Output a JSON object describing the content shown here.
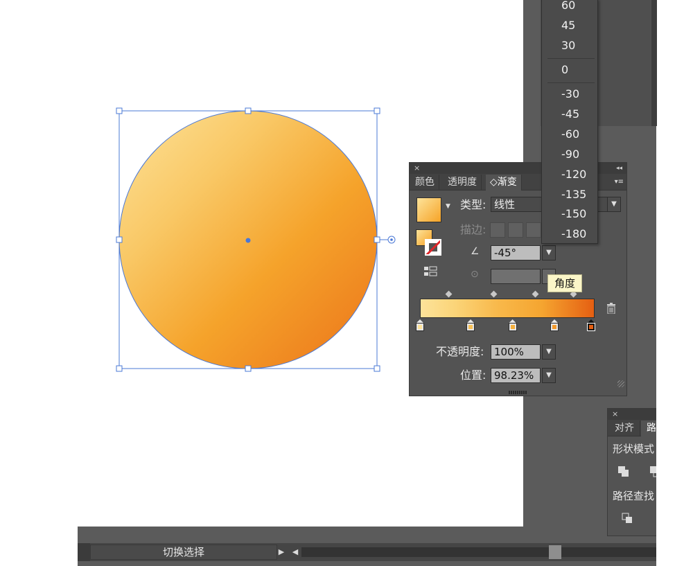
{
  "gradient_panel": {
    "close_glyph": "×",
    "collapse_glyph": "◂◂",
    "tabs": [
      {
        "label": "颜色"
      },
      {
        "label": "透明度"
      },
      {
        "label": "◇渐变"
      }
    ],
    "menu_glyph": "▾≡",
    "type_label": "类型:",
    "type_value": "线性",
    "stroke_label": "描边:",
    "angle_value": "-45°",
    "tooltip": "角度",
    "opacity_label": "不透明度:",
    "opacity_value": "100%",
    "position_label": "位置:",
    "position_value": "98.23%",
    "stops": [
      {
        "color": "#fde39a",
        "location": 0
      },
      {
        "color": "#f9c257",
        "location": 0.29
      },
      {
        "color": "#f7b13d",
        "location": 0.53
      },
      {
        "color": "#f39a2c",
        "location": 0.77
      },
      {
        "color": "#e55f12",
        "location": 0.98
      }
    ]
  },
  "angle_dropdown": {
    "items": [
      "60",
      "45",
      "30",
      "0",
      "-30",
      "-45",
      "-60",
      "-90",
      "-120",
      "-135",
      "-150",
      "-180"
    ]
  },
  "pathfinder_panel": {
    "close_glyph": "×",
    "tabs": [
      {
        "label": "对齐"
      },
      {
        "label": "路"
      }
    ],
    "shape_modes_label": "形状模式",
    "pathfinders_label": "路径查找"
  },
  "statusbar": {
    "selection_label": "切换选择",
    "play_glyph": "▶",
    "left_glyph": "◀"
  },
  "artwork": {
    "gradient_start": "#fde39a",
    "gradient_end": "#e55f12",
    "selection_color": "#4a78d6"
  }
}
